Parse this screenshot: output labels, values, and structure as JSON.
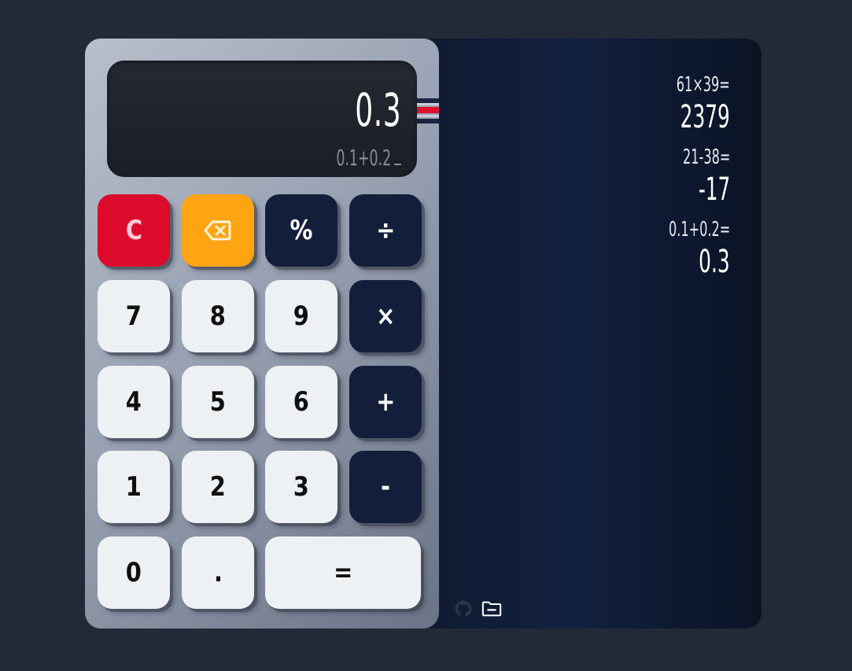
{
  "display": {
    "result": "0.3",
    "expression": "0.1+0.2"
  },
  "keypad": {
    "clear": "C",
    "backspace_icon": "backspace-icon",
    "percent": "%",
    "divide": "÷",
    "seven": "7",
    "eight": "8",
    "nine": "9",
    "multiply": "×",
    "four": "4",
    "five": "5",
    "six": "6",
    "plus": "+",
    "one": "1",
    "two": "2",
    "three": "3",
    "minus": "-",
    "zero": "0",
    "decimal": ".",
    "equals": "="
  },
  "history": [
    {
      "expression": "61×39=",
      "result": "2379"
    },
    {
      "expression": "21-38=",
      "result": "-17"
    },
    {
      "expression": "0.1+0.2=",
      "result": "0.3"
    }
  ],
  "footer": {
    "github_icon": "github-icon",
    "folder_icon": "folder-minus-icon"
  },
  "colors": {
    "background": "#222a38",
    "key_dark": "#131f3a",
    "key_light": "#eef1f3",
    "key_red": "#dc0b2c",
    "key_orange": "#ffa412"
  }
}
